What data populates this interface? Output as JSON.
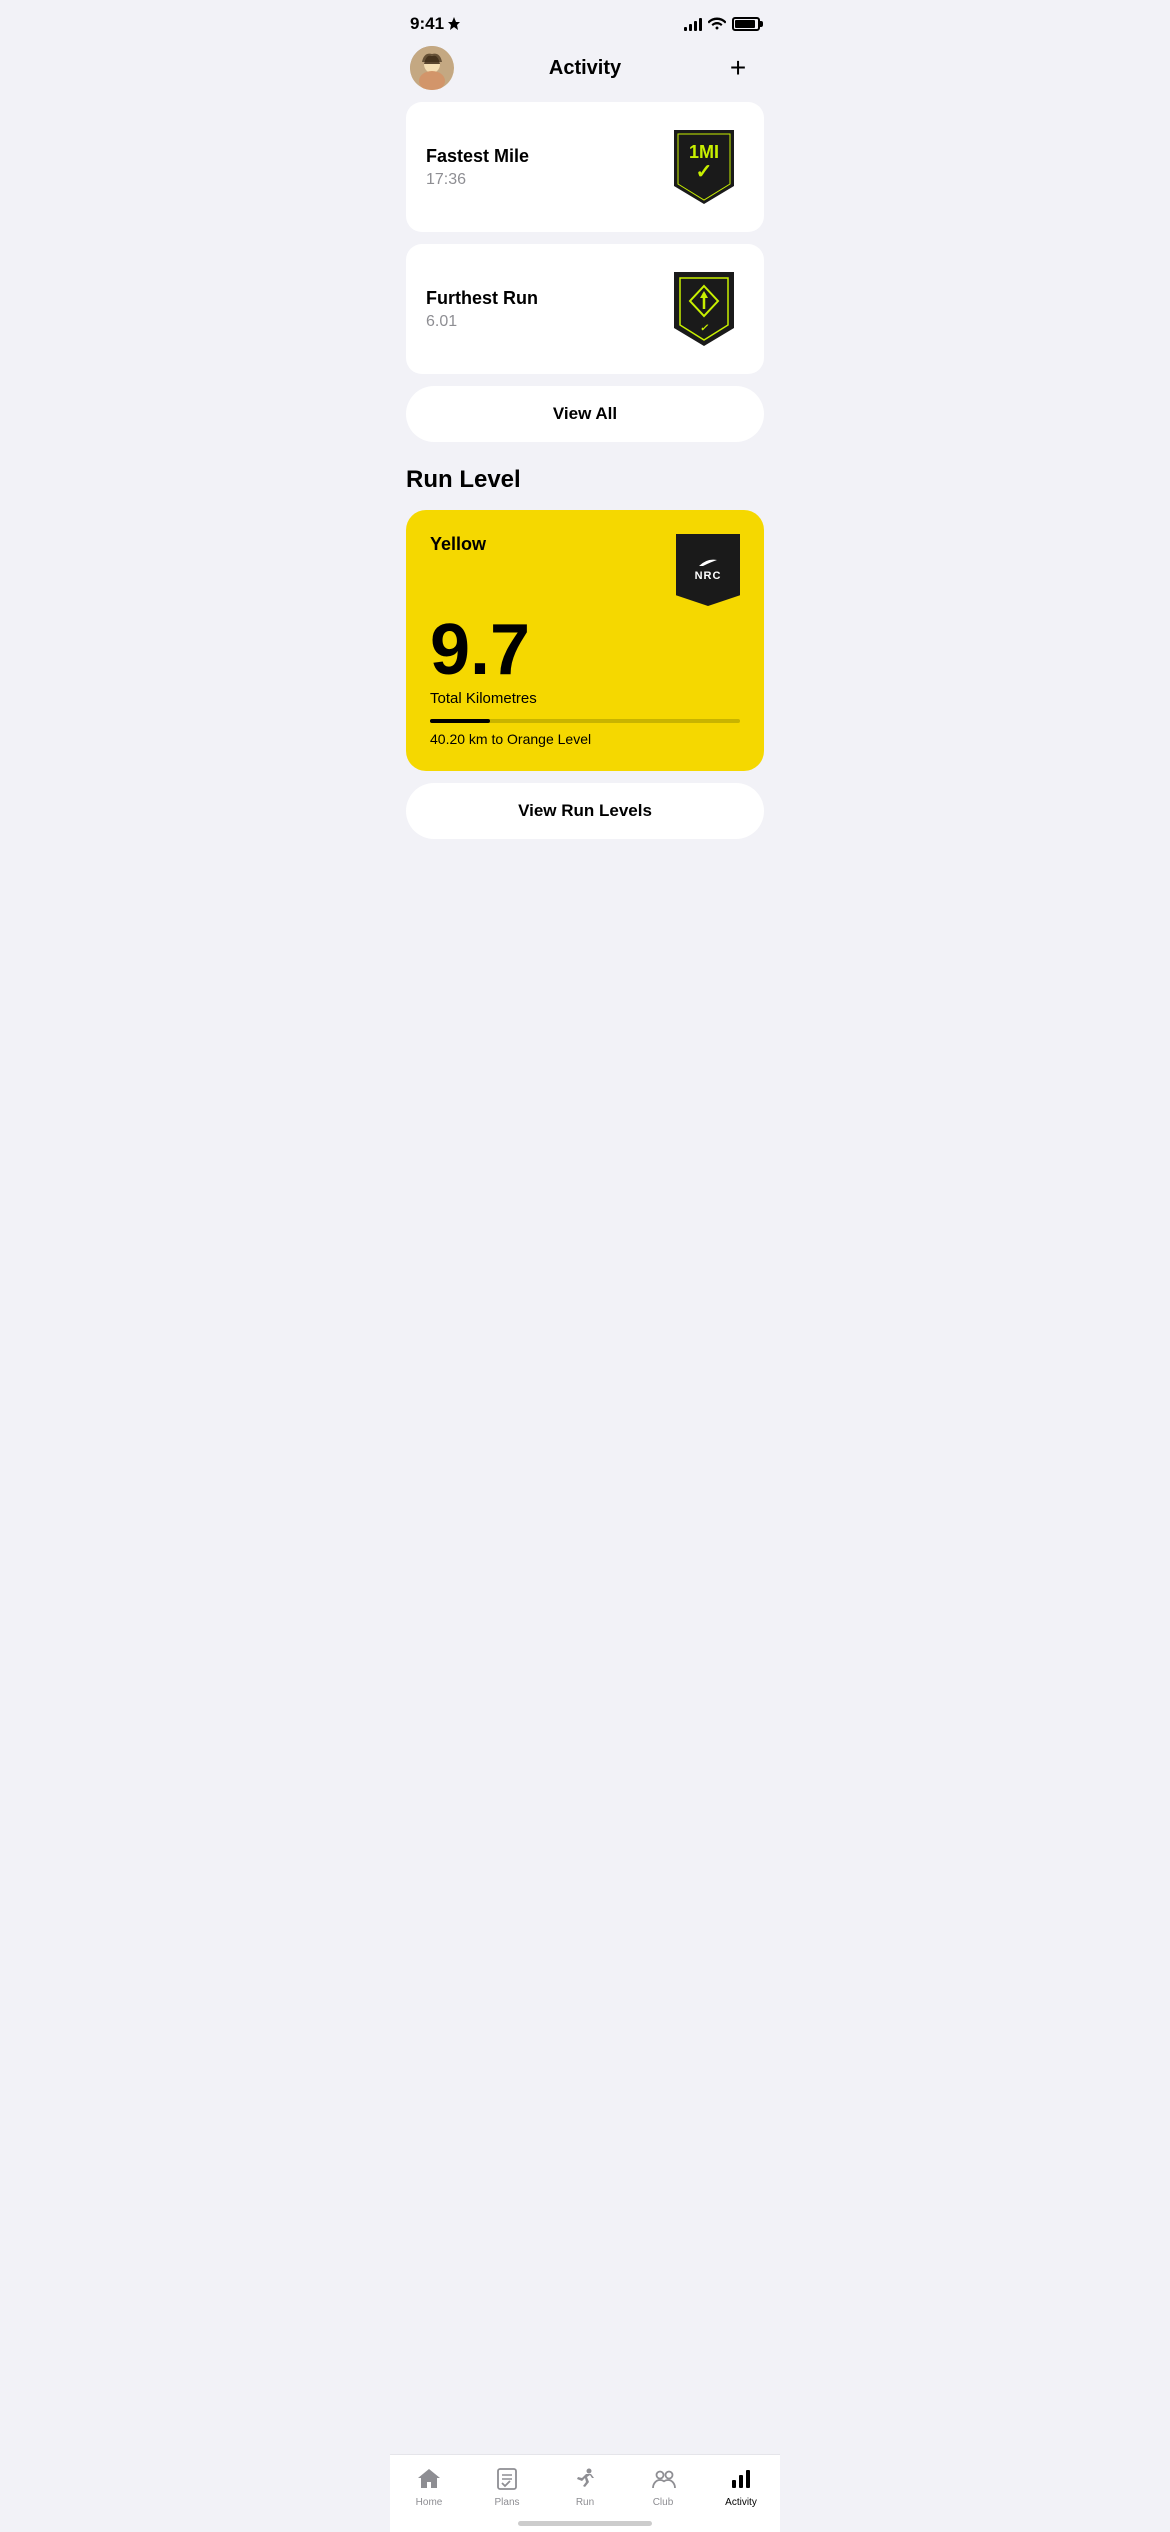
{
  "statusBar": {
    "time": "9:41",
    "hasLocation": true
  },
  "header": {
    "title": "Activity",
    "addButton": "+"
  },
  "achievements": [
    {
      "title": "Fastest Mile",
      "value": "17:36",
      "badgeType": "1mi"
    },
    {
      "title": "Furthest Run",
      "value": "6.01",
      "badgeType": "distance"
    }
  ],
  "viewAllButton": "View All",
  "runLevel": {
    "sectionTitle": "Run Level",
    "levelName": "Yellow",
    "totalKm": "9.7",
    "totalKmLabel": "Total Kilometres",
    "progressPercent": 19.5,
    "progressText": "40.20 km to Orange Level",
    "nrcLabel": "NRC"
  },
  "viewRunLevelsButton": "View Run Levels",
  "tabBar": {
    "items": [
      {
        "label": "Home",
        "icon": "home",
        "active": false
      },
      {
        "label": "Plans",
        "icon": "plans",
        "active": false
      },
      {
        "label": "Run",
        "icon": "run",
        "active": false
      },
      {
        "label": "Club",
        "icon": "club",
        "active": false
      },
      {
        "label": "Activity",
        "icon": "activity",
        "active": true
      }
    ]
  }
}
